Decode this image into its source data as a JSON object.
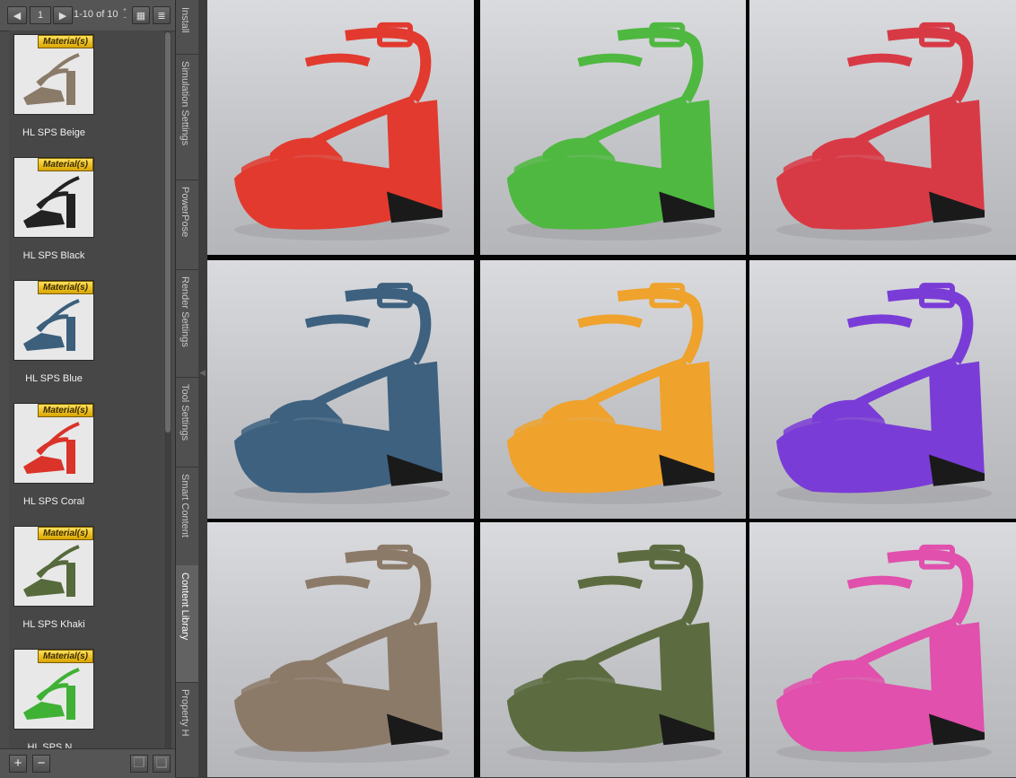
{
  "toolbar": {
    "prev_icon": "arrow-left-icon",
    "page": "1",
    "next_icon": "arrow-right-icon",
    "range": "1-10 of 10",
    "grid_view_icon": "grid-view-icon",
    "list_view_icon": "list-view-icon"
  },
  "items": [
    {
      "badge": "Material(s)",
      "label": "HL SPS Beige",
      "color": "#8a7a68"
    },
    {
      "badge": "Material(s)",
      "label": "HL SPS Black",
      "color": "#222222"
    },
    {
      "badge": "Material(s)",
      "label": "HL SPS Blue",
      "color": "#3c5f7c"
    },
    {
      "badge": "Material(s)",
      "label": "HL SPS Coral",
      "color": "#d9332a"
    },
    {
      "badge": "Material(s)",
      "label": "HL SPS Khaki",
      "color": "#566a3c"
    },
    {
      "badge": "Material(s)",
      "label": "HL SPS N...",
      "color": "#3fb135"
    }
  ],
  "tabs": [
    {
      "label": "Install",
      "active": false
    },
    {
      "label": "Simulation Settings",
      "active": false
    },
    {
      "label": "PowerPose",
      "active": false
    },
    {
      "label": "Render Settings",
      "active": false
    },
    {
      "label": "Tool Settings",
      "active": false
    },
    {
      "label": "Smart Content",
      "active": false
    },
    {
      "label": "Content Library",
      "active": true
    },
    {
      "label": "Property H",
      "active": false
    }
  ],
  "bottom": {
    "add": "+",
    "remove": "−"
  },
  "renders": [
    {
      "color": "#e23a2e"
    },
    {
      "color": "#4fb840"
    },
    {
      "color": "#d83a45"
    },
    {
      "color": "#3d617f"
    },
    {
      "color": "#efa22c"
    },
    {
      "color": "#7a3cd6"
    },
    {
      "color": "#8c7a68"
    },
    {
      "color": "#5c6c40"
    },
    {
      "color": "#e050ac"
    }
  ]
}
